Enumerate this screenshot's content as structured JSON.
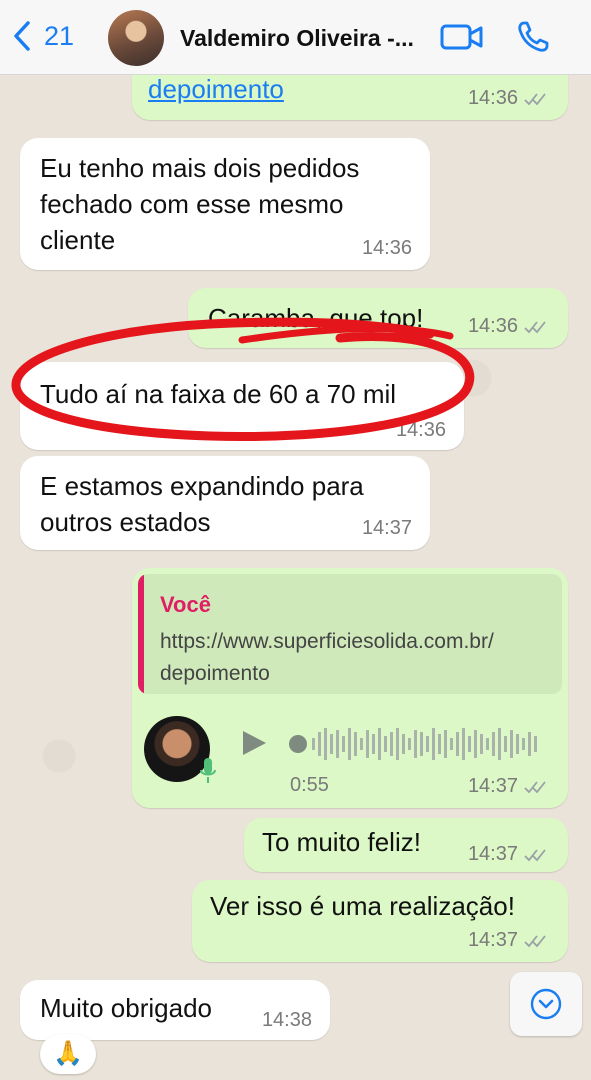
{
  "header": {
    "back_count": "21",
    "contact_name": "Valdemiro Oliveira -...",
    "icons": [
      "chevron-left-icon",
      "video-call-icon",
      "phone-call-icon"
    ]
  },
  "colors": {
    "incoming_bubble": "#ffffff",
    "outgoing_bubble": "#dcf8c6",
    "link": "#1a7ef2",
    "quote_author": "#e01e64",
    "annotation_red": "#e4161c"
  },
  "messages": [
    {
      "type": "out",
      "link": "depoimento",
      "time": "14:36"
    },
    {
      "type": "in",
      "text": "Eu tenho mais dois pedidos\nfechado com esse mesmo\ncliente",
      "time": "14:36"
    },
    {
      "type": "out",
      "text": "Caramba, que top!",
      "time": "14:36"
    },
    {
      "type": "in",
      "text": "Tudo aí na faixa de 60 a 70 mil",
      "time": "14:36"
    },
    {
      "type": "in",
      "text": "E estamos expandindo para\noutros estados",
      "time": "14:37"
    },
    {
      "type": "out",
      "quote_author": "Você",
      "quote_text": "https://www.superficiesolida.com.br/\ndepoimento",
      "voice_duration": "0:55",
      "time": "14:37"
    },
    {
      "type": "out",
      "text": "To muito feliz!",
      "time": "14:37"
    },
    {
      "type": "out",
      "text": "Ver isso é uma realização!",
      "time": "14:37"
    },
    {
      "type": "in",
      "text": "Muito obrigado",
      "time": "14:38"
    }
  ],
  "reaction": "🙏"
}
